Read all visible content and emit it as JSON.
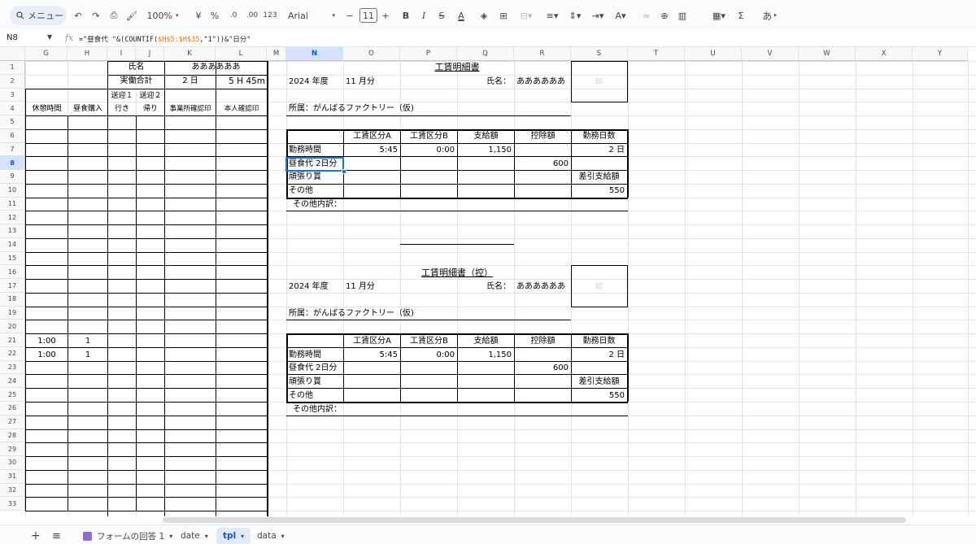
{
  "toolbar": {
    "menu_search": "メニュー",
    "zoom": "100%",
    "currency": "¥",
    "percent": "%",
    "dec_minus": ".0",
    "dec_plus": ".00",
    "number_format": "123",
    "font": "Arial",
    "font_size": "11",
    "bold": "B",
    "italic": "I",
    "text_color": "A",
    "sigma": "Σ",
    "ime": "あ"
  },
  "formula_bar": {
    "cell_ref": "N8",
    "fx": "fx",
    "formula_prefix": "=\"昼食代 \"&(COUNTIF(",
    "formula_range": "$H$5:$H$35",
    "formula_suffix": ",\"1\"))&\"日分\""
  },
  "columns": [
    "G",
    "H",
    "I",
    "J",
    "K",
    "L",
    "M",
    "N",
    "O",
    "P",
    "Q",
    "R",
    "S",
    "T",
    "U",
    "V",
    "W",
    "X",
    "Y"
  ],
  "rows": [
    "1",
    "2",
    "3",
    "4",
    "5",
    "6",
    "7",
    "8",
    "9",
    "10",
    "11",
    "12",
    "13",
    "14",
    "15",
    "16",
    "17",
    "18",
    "19",
    "20",
    "21",
    "22",
    "23",
    "24",
    "25",
    "26",
    "27",
    "28",
    "29",
    "30",
    "31",
    "32",
    "33"
  ],
  "left_sheet": {
    "name_label": "氏名",
    "name_value": "ああああああ",
    "total_label": "実働合計",
    "total_days": "2 日",
    "total_hours": "5 H 45m",
    "h_break": "休憩時間",
    "h_lunch": "昼食購入",
    "h_pickup1a": "送迎１",
    "h_pickup1b": "行き",
    "h_pickup2a": "送迎２",
    "h_pickup2b": "帰り",
    "h_office": "事業所確認印",
    "h_self": "本人確認印",
    "r21_break": "1:00",
    "r21_lunch": "1",
    "r22_break": "1:00",
    "r22_lunch": "1"
  },
  "slip1": {
    "title": "工賃明細書",
    "year": "2024 年度",
    "month": "11 月分",
    "name_label": "氏名：",
    "name": "ああああああ",
    "stamp": "印",
    "affil": "所属：がんばるファクトリー（仮)",
    "h_a": "工賃区分A",
    "h_b": "工賃区分B",
    "h_pay": "支給額",
    "h_ded": "控除額",
    "h_days": "勤務日数",
    "work_label": "勤務時間",
    "work_a": "5:45",
    "work_b": "0:00",
    "work_pay": "1,150",
    "days_value": "2 日",
    "lunch_label": "昼食代 2日分",
    "lunch_ded": "600",
    "effort_label": "頑張り賞",
    "net_label": "差引支給額",
    "other_label": "その他",
    "net_value": "550",
    "other_detail": "その他内訳："
  },
  "slip2": {
    "title": "工賃明細書（控）",
    "year": "2024 年度",
    "month": "11 月分",
    "name_label": "氏名：",
    "name": "ああああああ",
    "stamp": "印",
    "affil": "所属：がんばるファクトリー（仮)",
    "h_a": "工賃区分A",
    "h_b": "工賃区分B",
    "h_pay": "支給額",
    "h_ded": "控除額",
    "h_days": "勤務日数",
    "work_label": "勤務時間",
    "work_a": "5:45",
    "work_b": "0:00",
    "work_pay": "1,150",
    "days_value": "2 日",
    "lunch_label": "昼食代 2日分",
    "lunch_ded": "600",
    "effort_label": "頑張り賞",
    "net_label": "差引支給額",
    "other_label": "その他",
    "net_value": "550",
    "other_detail": "その他内訳："
  },
  "tabs": {
    "add": "+",
    "list": "≡",
    "form": "フォームの回答 1",
    "date": "date",
    "tpl": "tpl",
    "data": "data"
  },
  "colors": {
    "accent": "#1a73e8",
    "selected_header": "#d3e3fd",
    "active_tab": "#e1e9f7"
  }
}
